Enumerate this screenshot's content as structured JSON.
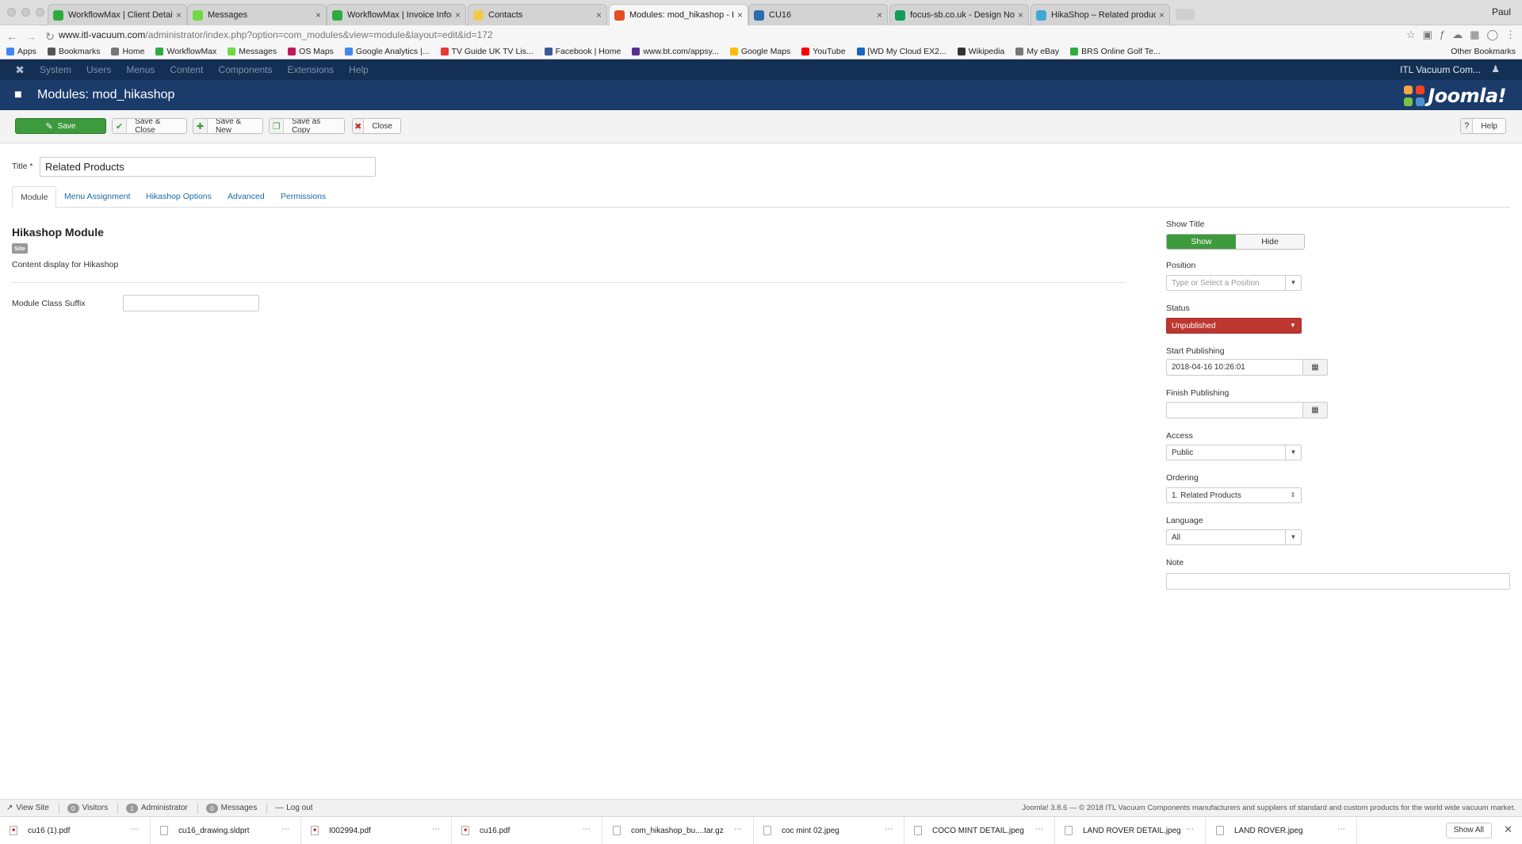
{
  "browser": {
    "tabs": [
      {
        "title": "WorkflowMax | Client Details",
        "icon": "workflowmax-icon",
        "color": "#2eab3e"
      },
      {
        "title": "Messages",
        "icon": "upwork-icon",
        "color": "#6fda44"
      },
      {
        "title": "WorkflowMax | Invoice Informa",
        "icon": "workflowmax-icon",
        "color": "#2eab3e"
      },
      {
        "title": "Contacts",
        "icon": "contacts-icon",
        "color": "#f2c94c"
      },
      {
        "title": "Modules: mod_hikashop - ITL",
        "icon": "joomla-icon",
        "color": "#e44d26"
      },
      {
        "title": "CU16",
        "icon": "doc-icon",
        "color": "#2b6cb0"
      },
      {
        "title": "focus-sb.co.uk - Design Notes",
        "icon": "sheets-icon",
        "color": "#0f9d58"
      },
      {
        "title": "HikaShop – Related products n",
        "icon": "hikashop-icon",
        "color": "#3fa9d6"
      }
    ],
    "profile": "Paul",
    "url_host": "www.itl-vacuum.com",
    "url_path": "/administrator/index.php?option=com_modules&view=module&layout=edit&id=172",
    "bookmarks": [
      "Apps",
      "Bookmarks",
      "Home",
      "WorkflowMax",
      "Messages",
      "OS Maps",
      "Google Analytics |...",
      "TV Guide UK TV Lis...",
      "Facebook | Home",
      "www.bt.com/appsy...",
      "Google Maps",
      "YouTube",
      "[WD My Cloud EX2...",
      "Wikipedia",
      "My eBay",
      "BRS Online Golf Te..."
    ],
    "other_bookmarks": "Other Bookmarks"
  },
  "admin_nav": {
    "menu": [
      "System",
      "Users",
      "Menus",
      "Content",
      "Components",
      "Extensions",
      "Help"
    ],
    "site_name": "ITL Vacuum Com...",
    "user_icon": "user-icon"
  },
  "header": {
    "title": "Modules: mod_hikashop",
    "logo_text": "Joomla!"
  },
  "toolbar": {
    "save": "Save",
    "save_close": "Save & Close",
    "save_new": "Save & New",
    "save_copy": "Save as Copy",
    "close": "Close",
    "help": "Help"
  },
  "form": {
    "title_label": "Title *",
    "title_value": "Related Products",
    "tabs": [
      "Module",
      "Menu Assignment",
      "Hikashop Options",
      "Advanced",
      "Permissions"
    ],
    "module_heading": "Hikashop Module",
    "site_badge": "Site",
    "description": "Content display for Hikashop",
    "class_suffix_label": "Module Class Suffix",
    "class_suffix_value": ""
  },
  "sidebar": {
    "show_title_label": "Show Title",
    "show": "Show",
    "hide": "Hide",
    "position_label": "Position",
    "position_placeholder": "Type or Select a Position",
    "status_label": "Status",
    "status_value": "Unpublished",
    "start_label": "Start Publishing",
    "start_value": "2018-04-16 10:26:01",
    "finish_label": "Finish Publishing",
    "finish_value": "",
    "access_label": "Access",
    "access_value": "Public",
    "ordering_label": "Ordering",
    "ordering_value": "1. Related Products",
    "language_label": "Language",
    "language_value": "All",
    "note_label": "Note",
    "note_value": ""
  },
  "statusbar": {
    "view_site": "View Site",
    "visitors_count": "0",
    "visitors": "Visitors",
    "admin_count": "1",
    "administrator": "Administrator",
    "messages_count": "0",
    "messages": "Messages",
    "logout": "Log out",
    "copyright": "Joomla! 3.8.6  —  © 2018 ITL Vacuum Components manufacturers and suppliers of standard and custom products for the world wide vacuum market."
  },
  "downloads": {
    "files": [
      "cu16 (1).pdf",
      "cu16_drawing.sldprt",
      "I002994.pdf",
      "cu16.pdf",
      "com_hikashop_bu....tar.gz",
      "coc mint 02.jpeg",
      "COCO MINT DETAIL.jpeg",
      "LAND ROVER DETAIL.jpeg",
      "LAND ROVER.jpeg"
    ],
    "show_all": "Show All"
  },
  "colors": {
    "accent_green": "#3d9a3d",
    "danger_red": "#bd362f",
    "nav_dark": "#132f53",
    "header_blue": "#1b3c6b"
  }
}
